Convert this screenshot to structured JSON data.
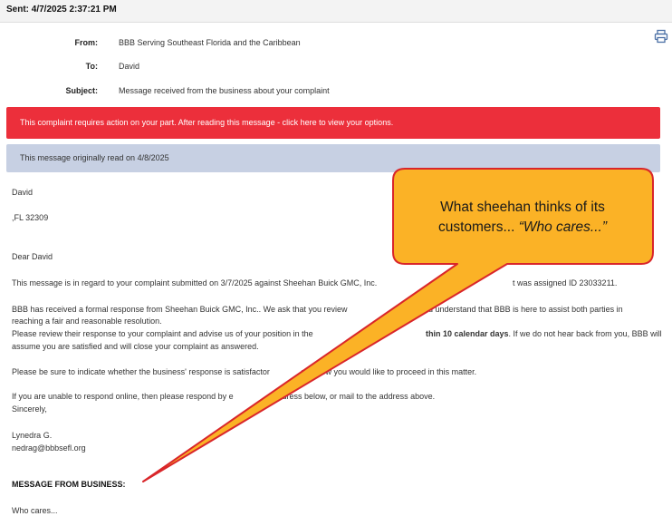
{
  "sent": "Sent: 4/7/2025 2:37:21 PM",
  "header": {
    "from_label": "From:",
    "from_value": "BBB Serving Southeast Florida and the Caribbean",
    "to_label": "To:",
    "to_value": "David",
    "subject_label": "Subject:",
    "subject_value": "Message received from the business about your complaint"
  },
  "icons": {
    "print": "printer-icon"
  },
  "banners": {
    "action": "This complaint requires action on your part. After reading this message - click here to view your options.",
    "read": "This message originally read on 4/8/2025"
  },
  "letter": {
    "name": "David",
    "address": ",FL 32309",
    "greeting": "Dear David",
    "p1": "This message is in regard to your complaint submitted on 3/7/2025 against Sheehan Buick GMC, Inc. ",
    "p1_tail": "t was assigned ID 23033211.",
    "p2_l1_a": "BBB has received a formal response from Sheehan Buick GMC, Inc.. We ask that you review ",
    "p2_l1_b": "and understand that BBB is here to assist both parties in",
    "p2_l2": "reaching a fair and reasonable resolution.",
    "p2_l3_a": "Please review their response to your complaint and advise us of your position in the ",
    "p2_l3_bold": "thin 10 calendar days",
    "p2_l3_b": ". If we do not hear back from you, BBB will",
    "p2_l4": "assume you are satisfied and will close your complaint as answered.",
    "p3_a": "Please be sure to indicate whether the business' response is satisfactor",
    "p3_b": "and how you would like to proceed in this matter.",
    "p4_a": "If you are unable to respond online, then please respond by e",
    "p4_b": "e address below, or mail to the address above.",
    "sincerely": "Sincerely,",
    "signer": "Lynedra G.",
    "email": "nedrag@bbbsefl.org"
  },
  "message": {
    "title": "MESSAGE FROM BUSINESS:",
    "body": "Who cares..."
  },
  "callout": {
    "line1": "What sheehan thinks of its",
    "line2_prefix": "customers... ",
    "line2_quote": "“Who cares...”"
  },
  "colors": {
    "red_banner": "#ec2f3b",
    "blue_banner": "#c7d0e3",
    "callout_fill": "#fbb226",
    "callout_stroke": "#d9262a"
  }
}
